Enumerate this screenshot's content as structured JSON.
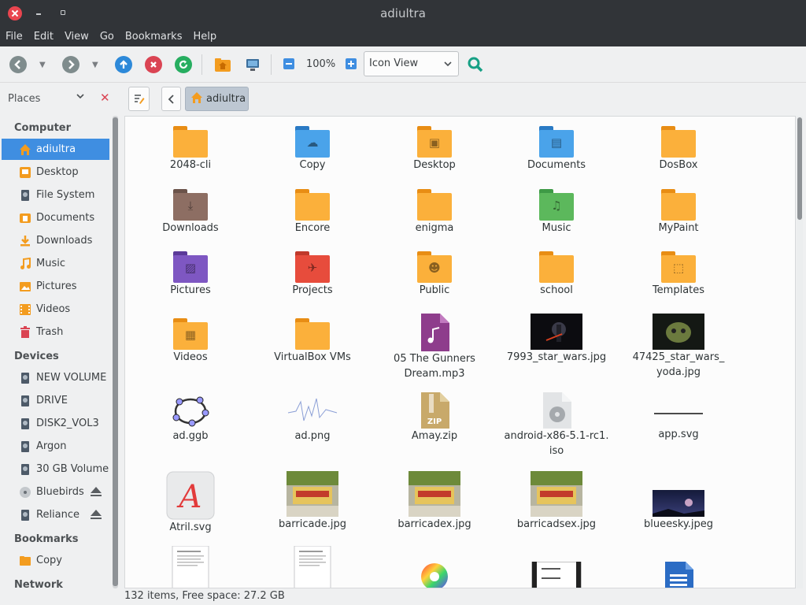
{
  "window": {
    "title": "adiultra"
  },
  "menu": [
    "File",
    "Edit",
    "View",
    "Go",
    "Bookmarks",
    "Help"
  ],
  "toolbar": {
    "zoom": "100%",
    "view_mode": "Icon View"
  },
  "location": {
    "places_label": "Places",
    "crumb": "adiultra"
  },
  "sidebar": {
    "sections": [
      {
        "title": "Computer",
        "items": [
          "adiultra",
          "Desktop",
          "File System",
          "Documents",
          "Downloads",
          "Music",
          "Pictures",
          "Videos",
          "Trash"
        ]
      },
      {
        "title": "Devices",
        "items": [
          "NEW VOLUME",
          "DRIVE",
          "DISK2_VOL3",
          "Argon",
          "30 GB Volume",
          "Bluebirds",
          "Reliance"
        ]
      },
      {
        "title": "Bookmarks",
        "items": [
          "Copy"
        ]
      },
      {
        "title": "Network",
        "items": []
      }
    ]
  },
  "files": [
    "2048-cli",
    "Copy",
    "Desktop",
    "Documents",
    "DosBox",
    "Downloads",
    "Encore",
    "enigma",
    "Music",
    "MyPaint",
    "Pictures",
    "Projects",
    "Public",
    "school",
    "Templates",
    "Videos",
    "VirtualBox VMs",
    "05 The Gunners Dream.mp3",
    "7993_star_wars.jpg",
    "47425_star_wars_ yoda.jpg",
    "ad.ggb",
    "ad.png",
    "Amay.zip",
    "android-x86-5.1-rc1. iso",
    "app.svg",
    "Atril.svg",
    "barricade.jpg",
    "barricadex.jpg",
    "barricadsex.jpg",
    "blueesky.jpeg"
  ],
  "status": "132 items, Free space: 27.2 GB",
  "colors": {
    "accent": "#3f8ee1",
    "folder": "#f9a72b",
    "titlebar": "#313438"
  }
}
